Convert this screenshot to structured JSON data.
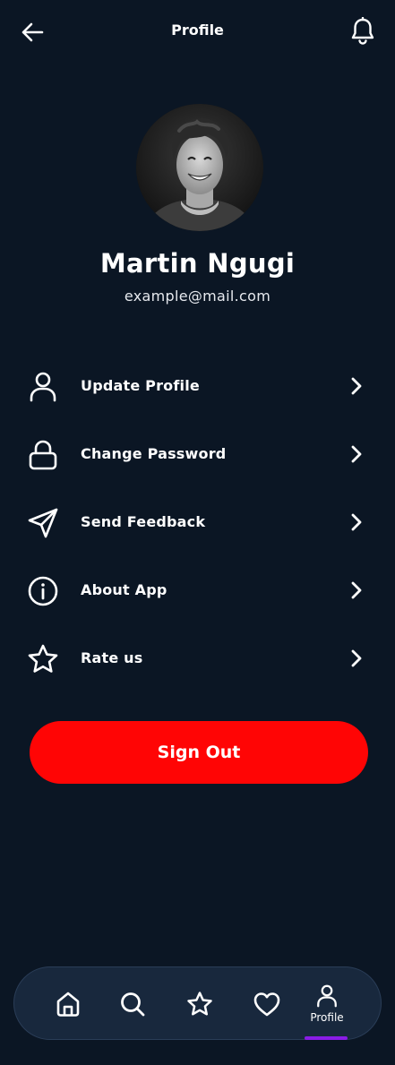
{
  "header": {
    "title": "Profile",
    "back_icon": "arrow-left-icon",
    "notification_icon": "bell-icon"
  },
  "profile": {
    "name": "Martin Ngugi",
    "email": "example@mail.com",
    "avatar": "user-photo"
  },
  "menu": {
    "items": [
      {
        "label": "Update Profile",
        "icon": "user-icon"
      },
      {
        "label": "Change Password",
        "icon": "lock-icon"
      },
      {
        "label": "Send Feedback",
        "icon": "send-icon"
      },
      {
        "label": "About App",
        "icon": "info-icon"
      },
      {
        "label": "Rate us",
        "icon": "star-icon"
      }
    ]
  },
  "sign_out": {
    "label": "Sign Out"
  },
  "bottom_nav": {
    "items": [
      {
        "icon": "home-icon"
      },
      {
        "icon": "search-icon"
      },
      {
        "icon": "star-icon"
      },
      {
        "icon": "heart-icon"
      },
      {
        "icon": "user-icon",
        "label": "Profile",
        "active": true
      }
    ]
  },
  "colors": {
    "background": "#0b1624",
    "nav_background": "#18283d",
    "sign_out": "#ff0505",
    "active_indicator": "#8a1ce6",
    "text": "#ffffff"
  }
}
